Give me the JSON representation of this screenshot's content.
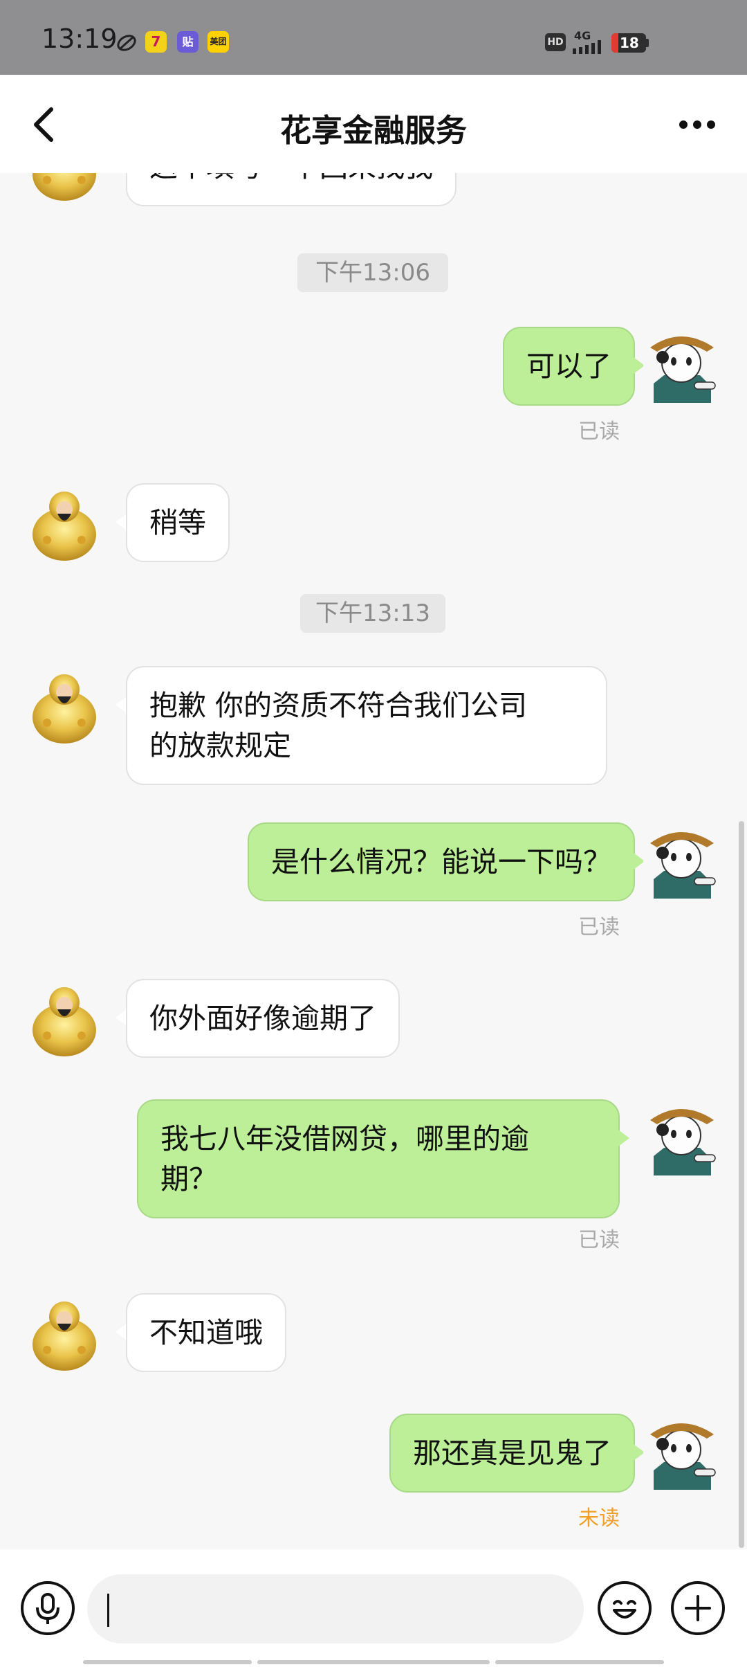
{
  "status_bar": {
    "time": "13:19",
    "apps": [
      "贴",
      "美团"
    ],
    "network": "4G",
    "battery": "18",
    "hd": "HD"
  },
  "header": {
    "title": "花享金融服务"
  },
  "messages": [
    {
      "from": "them",
      "text": "这个填写一下回来找我"
    },
    {
      "time": "下午13:06"
    },
    {
      "from": "me",
      "text": "可以了",
      "status": "已读"
    },
    {
      "from": "them",
      "text": "稍等"
    },
    {
      "time": "下午13:13"
    },
    {
      "from": "them",
      "text_lines": [
        "抱歉 你的资质不符合我们公司",
        "的放款规定"
      ]
    },
    {
      "from": "me",
      "text": "是什么情况？能说一下吗？",
      "status": "已读"
    },
    {
      "from": "them",
      "text": "你外面好像逾期了"
    },
    {
      "from": "me",
      "text_lines": [
        "我七八年没借网贷，哪里的逾",
        "期？"
      ],
      "status": "已读"
    },
    {
      "from": "them",
      "text": "不知道哦"
    },
    {
      "from": "me",
      "text": "那还真是见鬼了",
      "status": "未读"
    }
  ],
  "input": {
    "placeholder": ""
  },
  "colors": {
    "outgoing_bubble": "#bcef98",
    "incoming_bubble": "#ffffff",
    "unread": "#f0a028"
  }
}
